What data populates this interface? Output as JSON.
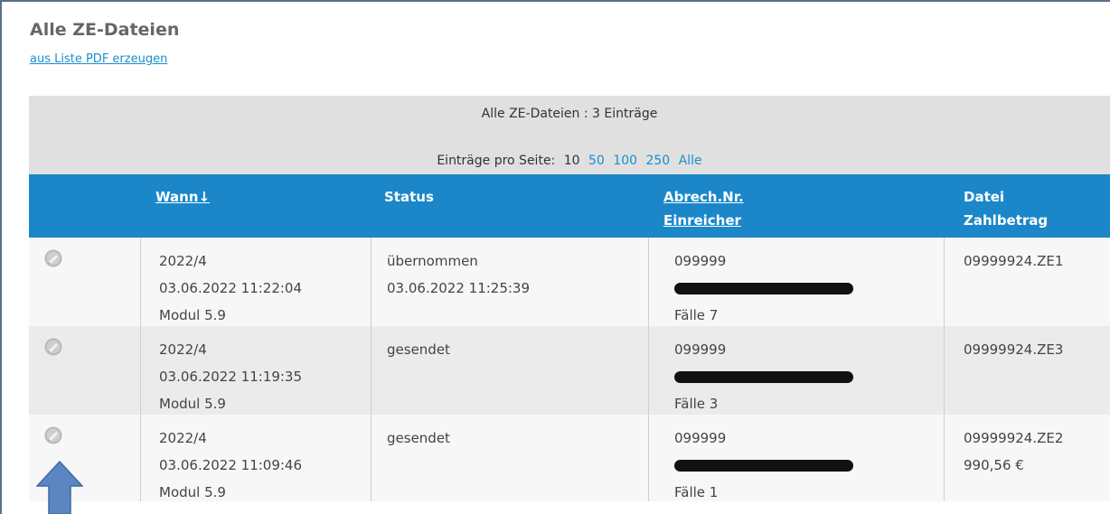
{
  "page": {
    "title": "Alle ZE-Dateien",
    "pdf_link": "aus Liste PDF erzeugen"
  },
  "summary": {
    "title": "Alle ZE-Dateien : 3 Einträge",
    "per_page_label": "Einträge pro Seite:",
    "per_page_options": [
      "10",
      "50",
      "100",
      "250",
      "Alle"
    ],
    "per_page_selected": "10"
  },
  "table": {
    "headers": {
      "wann": "Wann↓",
      "status": "Status",
      "abrech_nr": "Abrech.Nr.",
      "einreicher": "Einreicher",
      "datei": "Datei",
      "zahlbetrag": "Zahlbetrag"
    },
    "rows": [
      {
        "icon": "edit-pencil-disabled-icon",
        "period": "2022/4",
        "created": "03.06.2022 11:22:04",
        "module": "Modul 5.9",
        "status": "übernommen",
        "status_time": "03.06.2022 11:25:39",
        "abrech_nr": "099999",
        "einreicher": "[redacted]",
        "cases": "Fälle 7",
        "file": "09999924.ZE1",
        "amount": ""
      },
      {
        "icon": "edit-pencil-disabled-icon",
        "period": "2022/4",
        "created": "03.06.2022 11:19:35",
        "module": "Modul 5.9",
        "status": "gesendet",
        "status_time": "",
        "abrech_nr": "099999",
        "einreicher": "[redacted]",
        "cases": "Fälle 3",
        "file": "09999924.ZE3",
        "amount": ""
      },
      {
        "icon": "edit-pencil-disabled-icon",
        "period": "2022/4",
        "created": "03.06.2022 11:09:46",
        "module": "Modul 5.9",
        "status": "gesendet",
        "status_time": "",
        "abrech_nr": "099999",
        "einreicher": "[redacted]",
        "cases": "Fälle 1",
        "file": "09999924.ZE2",
        "amount": "990,56 €"
      }
    ]
  },
  "annotation": {
    "icon": "up-arrow-icon",
    "color": "#5b86c2"
  },
  "colors": {
    "header_bg": "#1b87c9",
    "link": "#1a8ed0",
    "summary_bg": "#e0e0e0"
  }
}
